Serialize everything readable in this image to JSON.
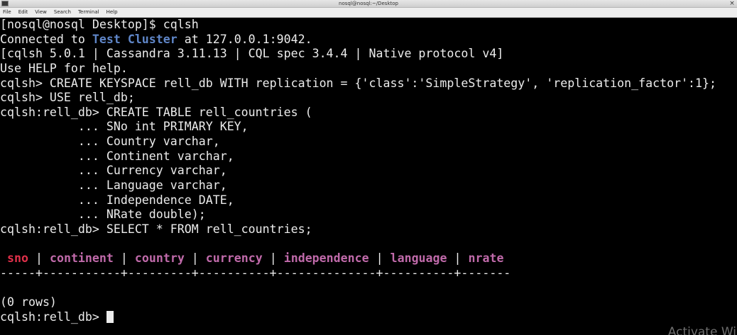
{
  "window": {
    "title": "nosql@nosql:~/Desktop",
    "close_glyph": "×"
  },
  "menu": {
    "items": [
      "File",
      "Edit",
      "View",
      "Search",
      "Terminal",
      "Help"
    ]
  },
  "terminal": {
    "lines": {
      "l0": "[nosql@nosql Desktop]$ cqlsh",
      "l1_a": "Connected to ",
      "l1_cluster": "Test Cluster",
      "l1_b": " at 127.0.0.1:9042.",
      "l2": "[cqlsh 5.0.1 | Cassandra 3.11.13 | CQL spec 3.4.4 | Native protocol v4]",
      "l3": "Use HELP for help.",
      "l4": "cqlsh> CREATE KEYSPACE rell_db WITH replication = {'class':'SimpleStrategy', 'replication_factor':1};",
      "l5": "cqlsh> USE rell_db;",
      "l6": "cqlsh:rell_db> CREATE TABLE rell_countries (",
      "l7": "           ... SNo int PRIMARY KEY,",
      "l8": "           ... Country varchar,",
      "l9": "           ... Continent varchar,",
      "l10": "           ... Currency varchar,",
      "l11": "           ... Language varchar,",
      "l12": "           ... Independence DATE,",
      "l13": "           ... NRate double);",
      "l14": "cqlsh:rell_db> SELECT * FROM rell_countries;",
      "l15": "",
      "l17": "-----+-----------+---------+----------+--------------+----------+-------",
      "l18": "",
      "l19": "(0 rows)",
      "l20": "cqlsh:rell_db> "
    },
    "result_header": {
      "lead": " ",
      "columns": [
        "sno",
        "continent",
        "country",
        "currency",
        "independence",
        "language",
        "nrate"
      ],
      "separator": " | "
    }
  },
  "watermark": {
    "text": "Activate Wir"
  },
  "colors": {
    "background": "#000000",
    "foreground": "#ececec",
    "cluster_name": "#5f86c8",
    "key_column": "#e0304a",
    "column": "#c06aaa"
  }
}
